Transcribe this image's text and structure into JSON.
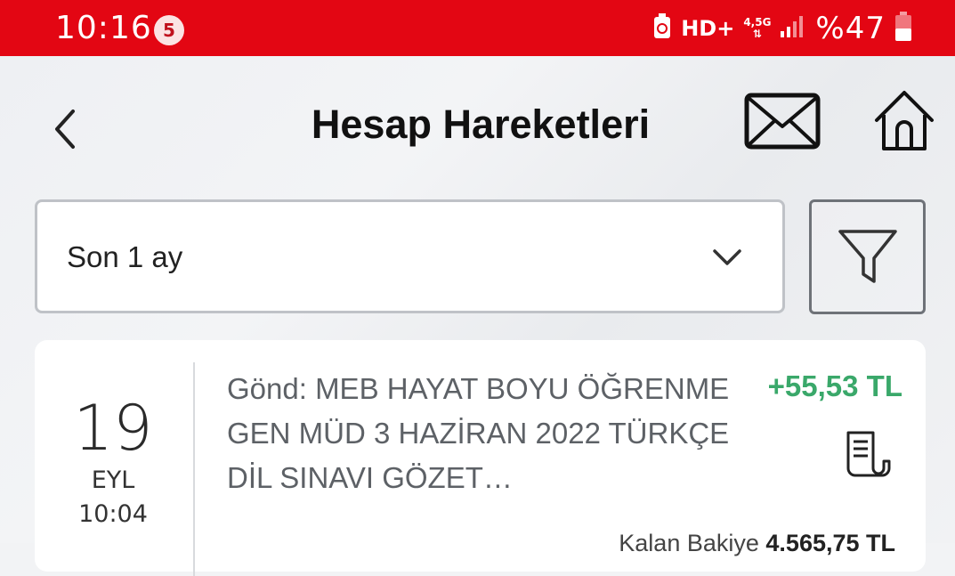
{
  "status_bar": {
    "time": "10:16",
    "notification_count": "5",
    "hd_label": "HD+",
    "network_label": "4,5G",
    "battery_text": "%47"
  },
  "header": {
    "title": "Hesap Hareketleri",
    "icons": [
      "back-icon",
      "mail-icon",
      "home-icon"
    ]
  },
  "filters": {
    "period_label": "Son 1 ay",
    "filter_icon": "filter-icon"
  },
  "transactions": [
    {
      "day": "19",
      "month": "EYL",
      "time": "10:04",
      "description": "Gönd: MEB HAYAT BOYU ÖĞRENME GEN MÜD 3 HAZİRAN 2022 TÜRKÇE DİL SINAVI GÖZET…",
      "amount": "+55,53 TL",
      "balance_label": "Kalan Bakiye",
      "balance_value": "4.565,75 TL"
    }
  ],
  "colors": {
    "brand_red": "#e30613",
    "credit_green": "#3aa86a"
  }
}
